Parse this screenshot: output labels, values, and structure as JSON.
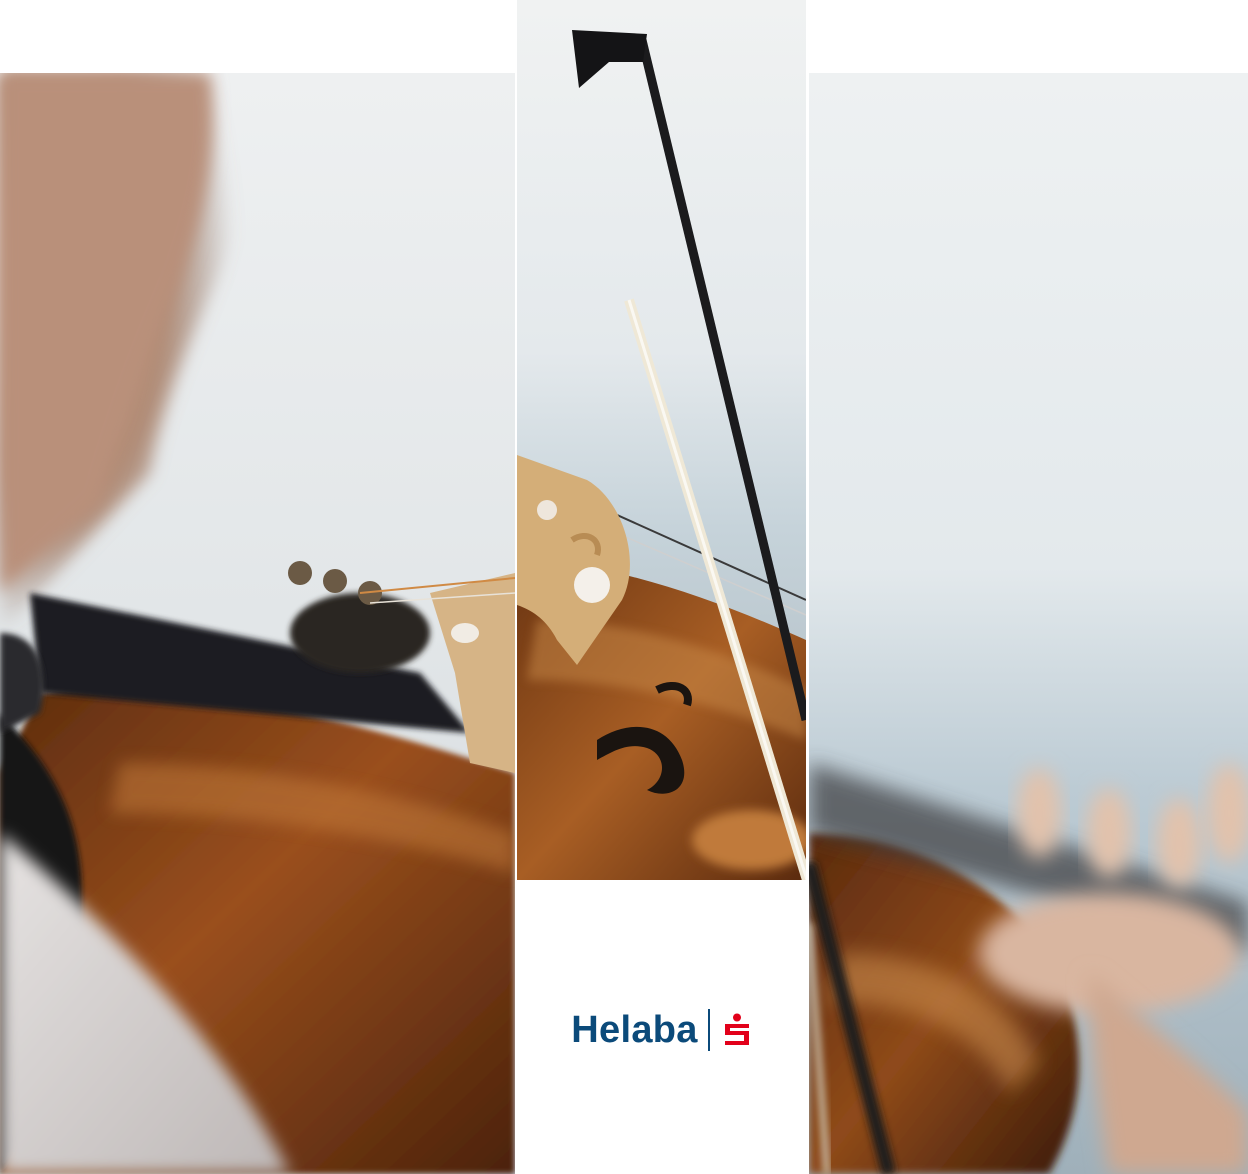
{
  "brand": {
    "wordmark": "Helaba",
    "wordmark_color": "#0b4a7a",
    "mark_color": "#e2001a",
    "mark_icon": "sparkasse-s-icon"
  },
  "photo": {
    "subject": "violin-playing",
    "palette": {
      "sky": "#e7edf1",
      "sky_blue": "#b9c9d3",
      "wood": "#7a3a12",
      "wood_light": "#b9702f",
      "bridge": "#d9b98a",
      "dark": "#1c1c20",
      "skin": "#d7b8a4"
    }
  }
}
